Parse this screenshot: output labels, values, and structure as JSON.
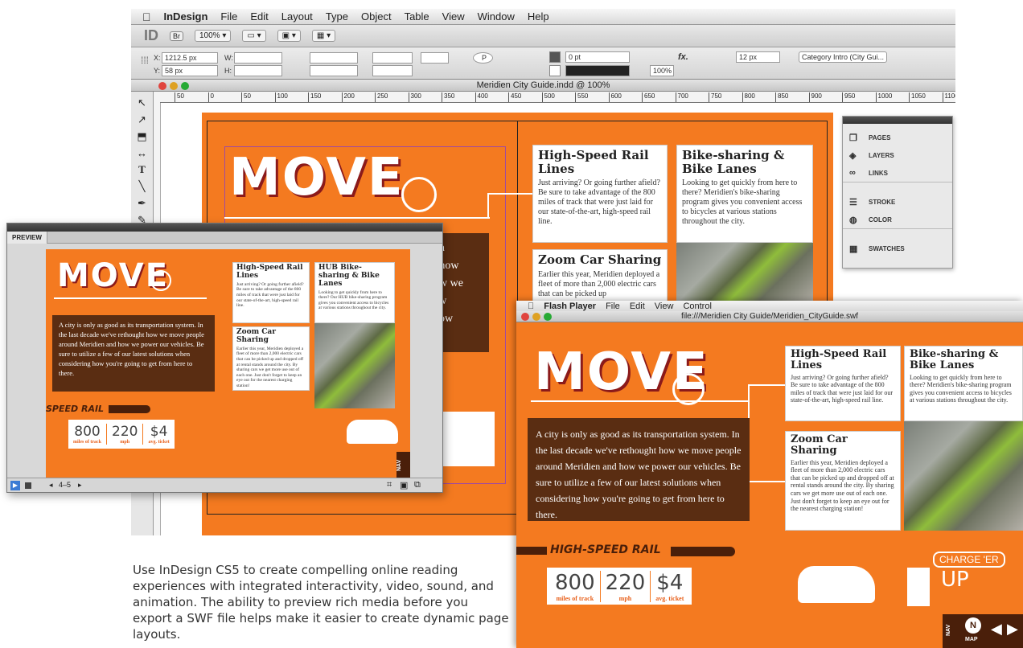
{
  "menubar": {
    "app": "InDesign",
    "items": [
      "File",
      "Edit",
      "Layout",
      "Type",
      "Object",
      "Table",
      "View",
      "Window",
      "Help"
    ]
  },
  "appbar": {
    "logo": "ID",
    "bridge": "Br",
    "zoom": "100%"
  },
  "control": {
    "x_label": "X:",
    "x_value": "1212.5 px",
    "y_label": "Y:",
    "y_value": "58 px",
    "w_label": "W:",
    "h_label": "H:",
    "stroke_weight": "0 pt",
    "scale": "100%",
    "spacing": "12 px",
    "object_style": "Category Intro (City Gui...",
    "p_glyph": "P",
    "fx": "fx."
  },
  "document": {
    "title": "Meridien City Guide.indd @ 100%"
  },
  "ruler": {
    "ticks": [
      "50",
      "0",
      "50",
      "100",
      "150",
      "200",
      "250",
      "300",
      "350",
      "400",
      "450",
      "500",
      "550",
      "600",
      "650",
      "700",
      "750",
      "800",
      "850",
      "900",
      "950",
      "1000",
      "1050",
      "1100"
    ]
  },
  "panel": {
    "items": [
      {
        "icon": "pages-icon",
        "label": "PAGES"
      },
      {
        "icon": "layers-icon",
        "label": "LAYERS"
      },
      {
        "icon": "links-icon",
        "label": "LINKS"
      },
      {
        "icon": "stroke-icon",
        "label": "STROKE"
      },
      {
        "icon": "color-icon",
        "label": "COLOR"
      },
      {
        "icon": "swatches-icon",
        "label": "SWATCHES"
      }
    ]
  },
  "spread": {
    "move": "MOVE",
    "card1_title": "High-Speed Rail Lines",
    "card1_body": "Just arriving? Or going further afield? Be sure to take advantage of the 800 miles of track that were just laid for our state-of-the-art, high-speed rail line.",
    "card2_title": "Bike-sharing & Bike Lanes",
    "card2_body": "Looking to get quickly from here to there? Meridien's bike-sharing program gives you convenient access to bicycles at various stations throughout the city.",
    "card3_title": "Zoom Car Sharing",
    "card3_body": "Earlier this year, Meridien deployed a fleet of more than 2,000 electric cars that can be picked up",
    "brown_lines": [
      "on",
      "t how",
      "ow we",
      "ew",
      "how"
    ]
  },
  "preview": {
    "tab": "PREVIEW",
    "move": "MOVE",
    "intro": "A city is only as good as its transportation system. In the last decade we've rethought  how we move people around Meridien and how we power our vehicles.  Be sure to utilize a few of our latest solutions when considering how you're going to get from here to there.",
    "card1_title": "High-Speed Rail Lines",
    "card1_body": "Just arriving? Or going further afield? Be sure to take advantage of the 800 miles of track that were just laid for our state-of-the-art, high-speed rail line.",
    "card2_title": "HUB Bike-sharing & Bike Lanes",
    "card2_body": "Looking to get quickly from here to there? Our HUB bike-sharing program gives you convenient access to bicycles at various stations throughout the city.",
    "card3_title": "Zoom Car Sharing",
    "card3_body": "Earlier this year, Meridien deployed a fleet of more than 2,000 electric cars that can be picked up and dropped off at rental stands around the city. By sharing cars we get more use out of each one. Just don't forget to keep an eye out for the nearest charging station!",
    "rail": "SPEED RAIL",
    "stats": [
      {
        "n": "800",
        "u": "miles of track"
      },
      {
        "n": "220",
        "u": "mph"
      },
      {
        "n": "$4",
        "u": "avg. ticket"
      }
    ],
    "nav": "NAV",
    "pages": "4–5"
  },
  "flash": {
    "app": "Flash Player",
    "menu": [
      "File",
      "Edit",
      "View",
      "Control"
    ],
    "title": "file:///Meridien City Guide/Meridien_CityGuide.swf",
    "move": "MOVE",
    "intro": "A city is only as good as its transportation system. In the last decade we've rethought  how we move people around Meridien and how we power our vehicles.  Be sure to utilize a few of our latest solutions when considering how you're going to get from here to there.",
    "card1_title": "High-Speed Rail Lines",
    "card1_body": "Just arriving? Or going further afield? Be sure to take advantage of the 800 miles of track that were just laid for our state-of-the-art, high-speed rail line.",
    "card2_title": "Bike-sharing & Bike Lanes",
    "card2_body": "Looking to get quickly from here to there? Meridien's bike-sharing program gives you convenient access to bicycles at various stations throughout the city.",
    "card3_title": "Zoom Car Sharing",
    "card3_body": "Earlier this year, Meridien deployed a fleet of more than 2,000 electric cars that can be picked up and dropped off at rental stands around the city. By sharing cars we get more use out of each one. Just don't forget to keep an eye out for the nearest charging station!",
    "rail": "HIGH-SPEED RAIL",
    "stats": [
      {
        "n": "800",
        "u": "miles of track"
      },
      {
        "n": "220",
        "u": "mph"
      },
      {
        "n": "$4",
        "u": "avg. ticket"
      }
    ],
    "charge": "CHARGE 'ER",
    "up": "UP",
    "nav": "NAV",
    "map": "MAP"
  },
  "caption": "Use InDesign CS5 to create compelling online reading experiences with integrated interactivity, video, sound, and animation. The ability to preview rich media before you export a SWF file helps make it easier to create dynamic page layouts."
}
